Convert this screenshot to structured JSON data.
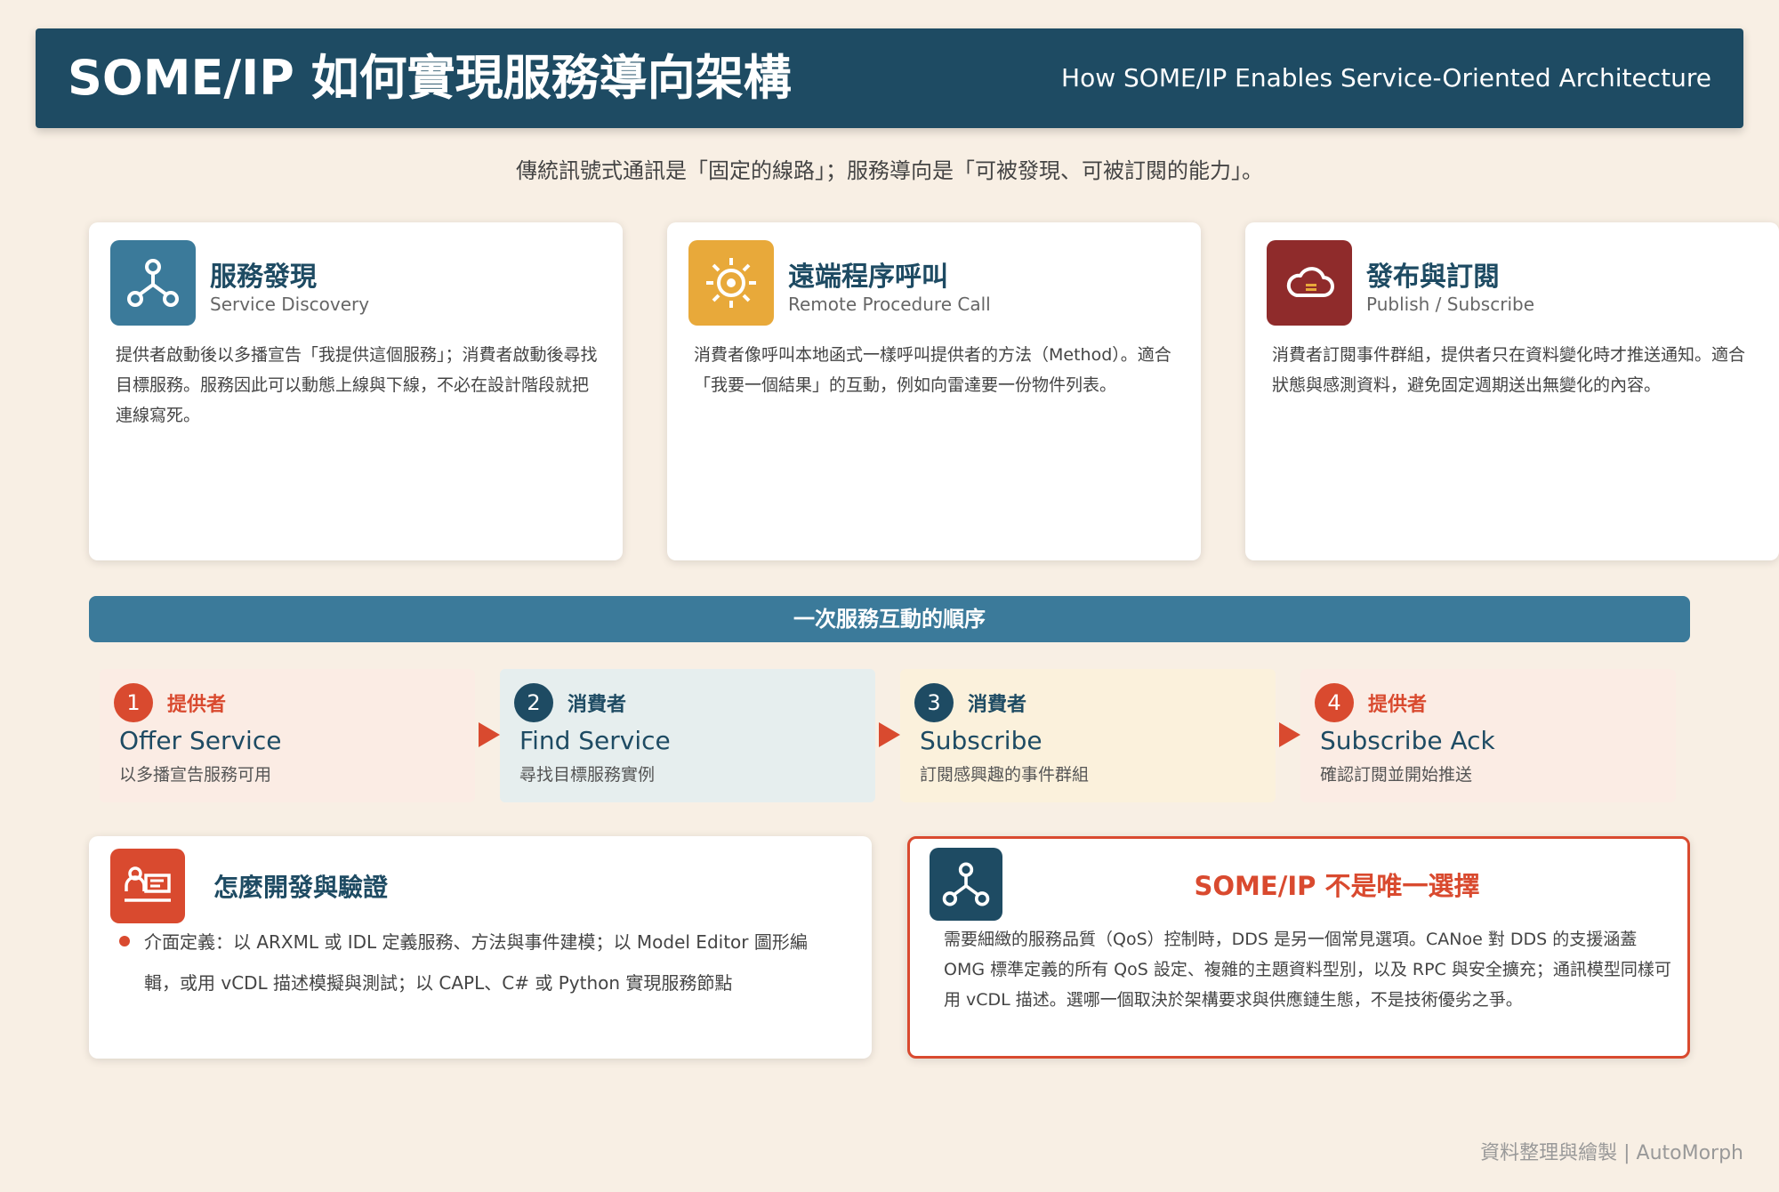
{
  "header": {
    "title": "SOME/IP 如何實現服務導向架構",
    "subtitle": "How SOME/IP Enables Service-Oriented Architecture"
  },
  "tagline": "傳統訊號式通訊是「固定的線路」；服務導向是「可被發現、可被訂閱的能力」。",
  "cards": [
    {
      "icon": "network-nodes-icon",
      "title": "服務發現",
      "subtitle": "Service Discovery",
      "body": "提供者啟動後以多播宣告「我提供這個服務」；消費者啟動後尋找目標服務。服務因此可以動態上線與下線，不必在設計階段就把連線寫死。",
      "icon_color": "#3b7a9a"
    },
    {
      "icon": "gear-sun-icon",
      "title": "遠端程序呼叫",
      "subtitle": "Remote Procedure Call",
      "body": "消費者像呼叫本地函式一樣呼叫提供者的方法（Method）。適合「我要一個結果」的互動，例如向雷達要一份物件列表。",
      "icon_color": "#e8a93a"
    },
    {
      "icon": "cloud-icon",
      "title": "發布與訂閱",
      "subtitle": "Publish / Subscribe",
      "body": "消費者訂閱事件群組，提供者只在資料變化時才推送通知。適合狀態與感測資料，避免固定週期送出無變化的內容。",
      "icon_color": "#8f2b2b"
    }
  ],
  "sequence": {
    "title": "一次服務互動的順序",
    "steps": [
      {
        "num": "1",
        "role": "提供者",
        "en": "Offer Service",
        "zh": "以多播宣告服務可用",
        "accent": "#d94a2f",
        "bg": "#fbece4"
      },
      {
        "num": "2",
        "role": "消費者",
        "en": "Find Service",
        "zh": "尋找目標服務實例",
        "accent": "#1e4b63",
        "bg": "#e6eeee"
      },
      {
        "num": "3",
        "role": "消費者",
        "en": "Subscribe",
        "zh": "訂閱感興趣的事件群組",
        "accent": "#1e4b63",
        "bg": "#fbf1dc"
      },
      {
        "num": "4",
        "role": "提供者",
        "en": "Subscribe Ack",
        "zh": "確認訂閱並開始推送",
        "accent": "#d94a2f",
        "bg": "#fbece4"
      }
    ]
  },
  "dev": {
    "icon": "developer-screen-icon",
    "title": "怎麼開發與驗證",
    "body": "介面定義：以 ARXML 或 IDL 定義服務、方法與事件建模；以 Model Editor 圖形編輯，或用 vCDL 描述模擬與測試；以 CAPL、C# 或 Python 實現服務節點"
  },
  "alt": {
    "icon": "network-nodes-icon",
    "title": "SOME/IP 不是唯一選擇",
    "body": "需要細緻的服務品質（QoS）控制時，DDS 是另一個常見選項。CANoe 對 DDS 的支援涵蓋 OMG 標準定義的所有 QoS 設定、複雜的主題資料型別，以及 RPC 與安全擴充；通訊模型同樣可用 vCDL 描述。選哪一個取決於架構要求與供應鏈生態，不是技術優劣之爭。"
  },
  "footer": "資料整理與繪製 | AutoMorph",
  "colors": {
    "navy": "#1e4b63",
    "teal": "#3b7a9a",
    "accent_red": "#d94a2f",
    "background": "#f8efe4"
  }
}
